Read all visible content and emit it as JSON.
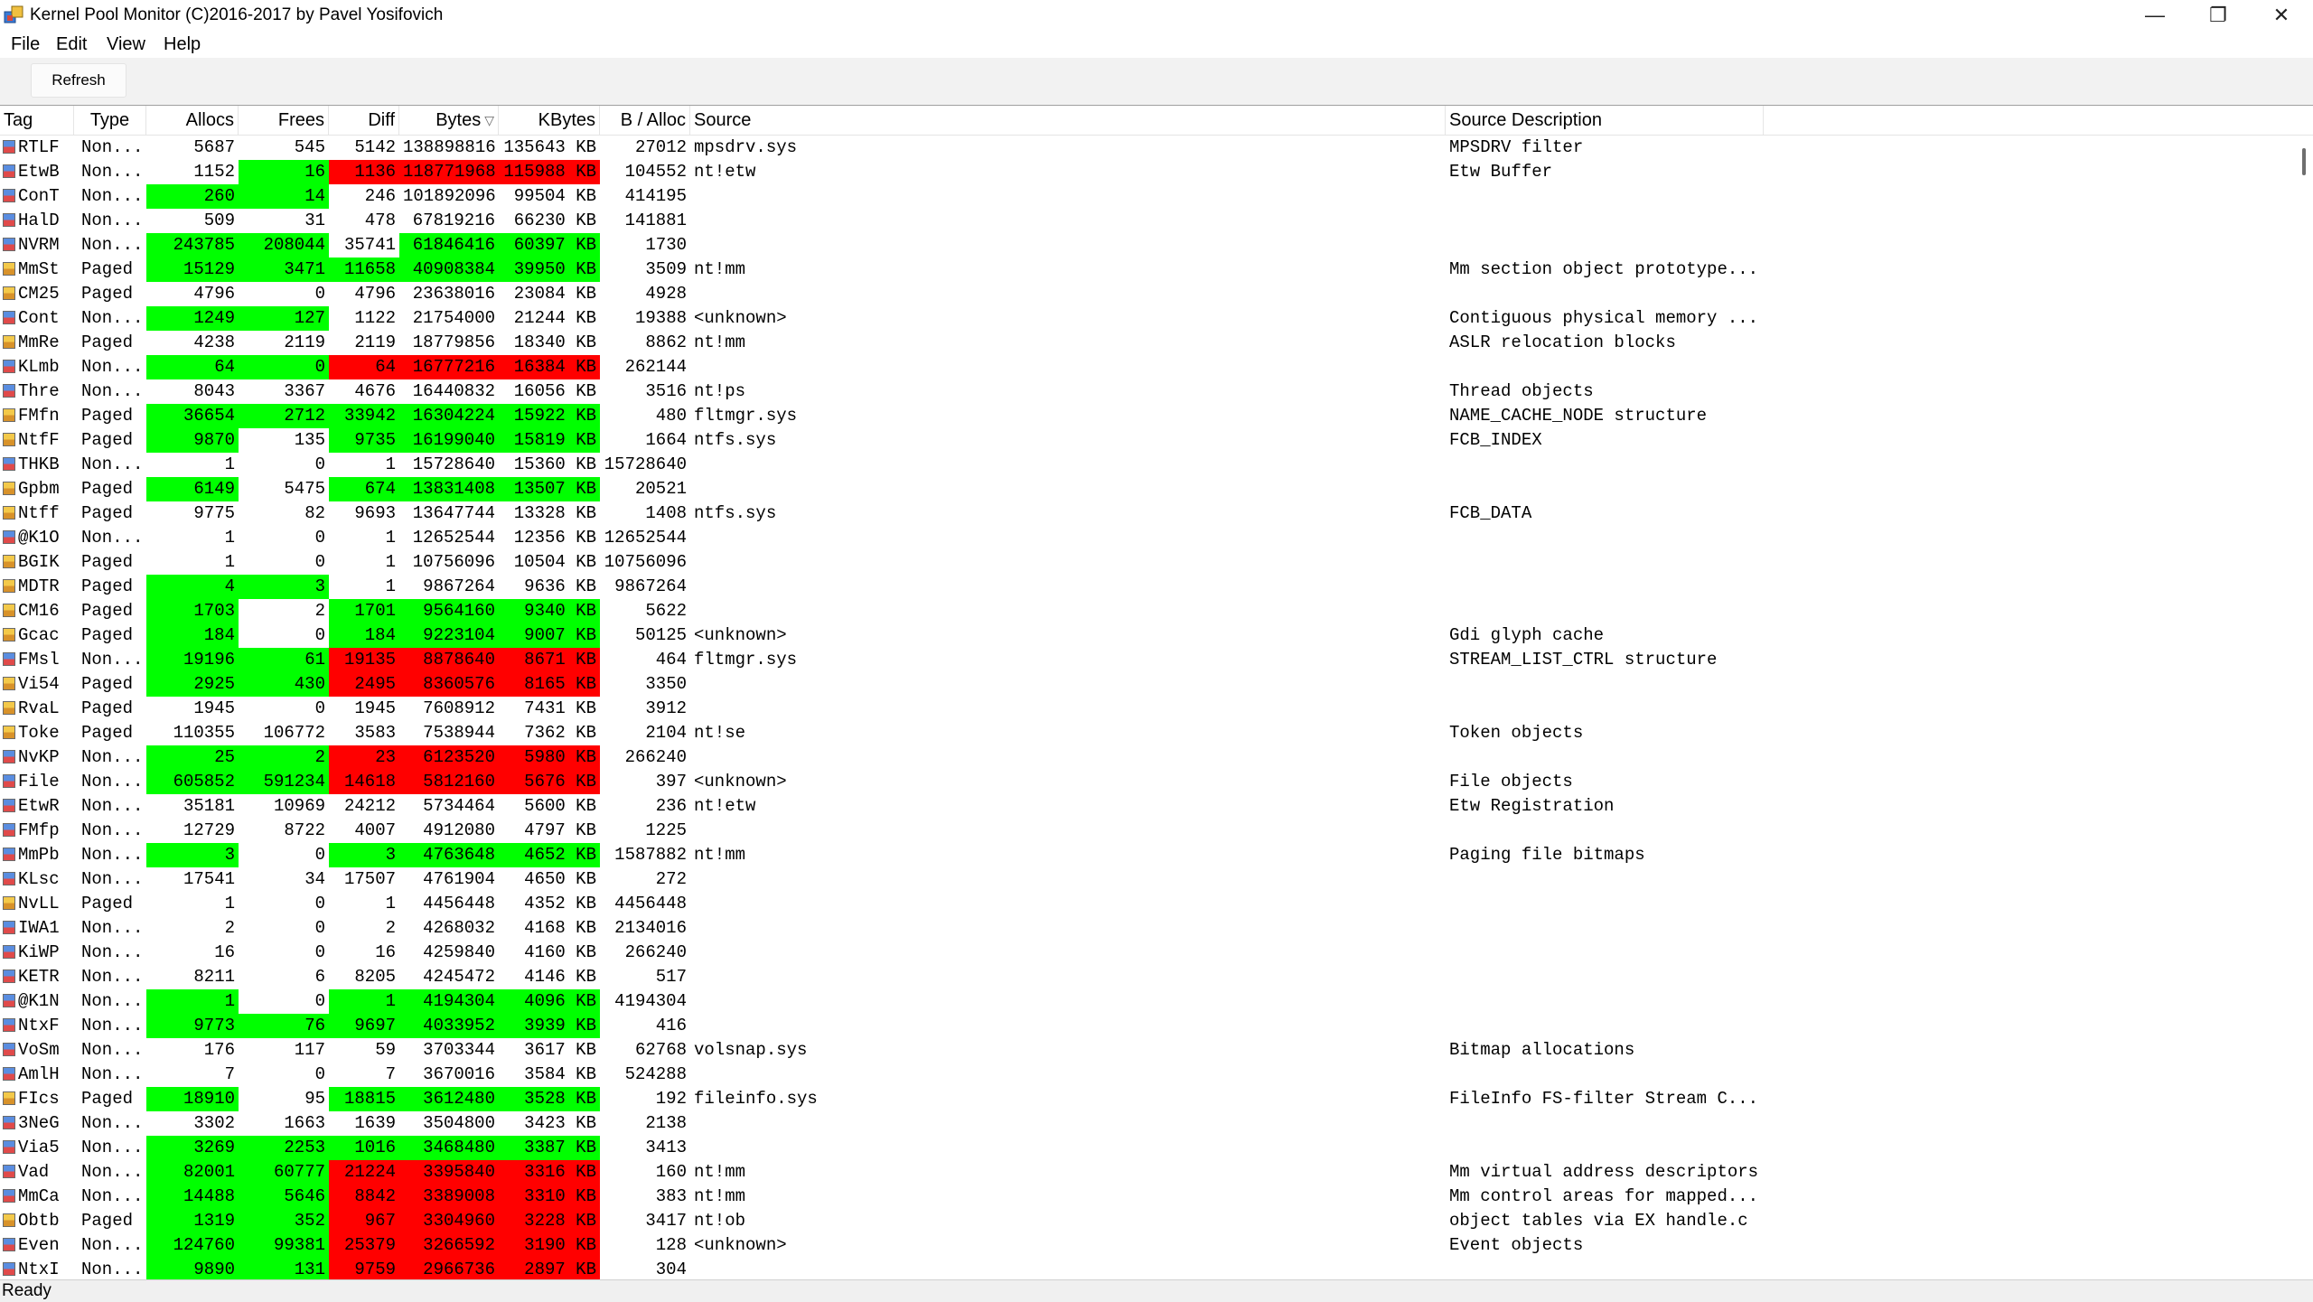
{
  "window": {
    "title": "Kernel Pool Monitor (C)2016-2017 by Pavel Yosifovich",
    "icon": "pool-monitor-icon",
    "controls": {
      "minimize": "—",
      "restore": "❐",
      "close": "✕"
    }
  },
  "menu": {
    "file": "File",
    "edit": "Edit",
    "view": "View",
    "help": "Help"
  },
  "toolbar": {
    "refresh_label": "Refresh"
  },
  "table": {
    "columns": {
      "tag": "Tag",
      "type": "Type",
      "allocs": "Allocs",
      "frees": "Frees",
      "diff": "Diff",
      "bytes": "Bytes",
      "kbytes": "KBytes",
      "balloc": "B / Alloc",
      "source": "Source",
      "desc": "Source Description"
    },
    "sort_column": "Bytes",
    "sort_direction": "descending",
    "colors": {
      "increase": "#00ff00",
      "decrease": "#ff0000"
    },
    "rows": [
      {
        "tag": "RTLF",
        "type": "Non...",
        "allocs": "5687",
        "frees": "545",
        "diff": "5142",
        "bytes": "138898816",
        "kbytes": "135643 KB",
        "balloc": "27012",
        "source": "mpsdrv.sys",
        "desc": "MPSDRV filter",
        "hl": [
          "",
          "",
          "",
          "",
          ""
        ]
      },
      {
        "tag": "EtwB",
        "type": "Non...",
        "allocs": "1152",
        "frees": "16",
        "diff": "1136",
        "bytes": "118771968",
        "kbytes": "115988 KB",
        "balloc": "104552",
        "source": "nt!etw",
        "desc": "Etw Buffer",
        "hl": [
          "",
          "g",
          "rd",
          "rd",
          "rd"
        ]
      },
      {
        "tag": "ConT",
        "type": "Non...",
        "allocs": "260",
        "frees": "14",
        "diff": "246",
        "bytes": "101892096",
        "kbytes": "99504 KB",
        "balloc": "414195",
        "source": "",
        "desc": "",
        "hl": [
          "g",
          "g",
          "",
          "",
          ""
        ]
      },
      {
        "tag": "HalD",
        "type": "Non...",
        "allocs": "509",
        "frees": "31",
        "diff": "478",
        "bytes": "67819216",
        "kbytes": "66230 KB",
        "balloc": "141881",
        "source": "",
        "desc": "",
        "hl": [
          "",
          "",
          "",
          "",
          ""
        ]
      },
      {
        "tag": "NVRM",
        "type": "Non...",
        "allocs": "243785",
        "frees": "208044",
        "diff": "35741",
        "bytes": "61846416",
        "kbytes": "60397 KB",
        "balloc": "1730",
        "source": "",
        "desc": "",
        "hl": [
          "g",
          "g",
          "",
          "g",
          "g"
        ]
      },
      {
        "tag": "MmSt",
        "type": "Paged",
        "allocs": "15129",
        "frees": "3471",
        "diff": "11658",
        "bytes": "40908384",
        "kbytes": "39950 KB",
        "balloc": "3509",
        "source": "nt!mm",
        "desc": "Mm section object prototype...",
        "hl": [
          "g",
          "g",
          "g",
          "g",
          "g"
        ]
      },
      {
        "tag": "CM25",
        "type": "Paged",
        "allocs": "4796",
        "frees": "0",
        "diff": "4796",
        "bytes": "23638016",
        "kbytes": "23084 KB",
        "balloc": "4928",
        "source": "",
        "desc": "",
        "hl": [
          "",
          "",
          "",
          "",
          ""
        ]
      },
      {
        "tag": "Cont",
        "type": "Non...",
        "allocs": "1249",
        "frees": "127",
        "diff": "1122",
        "bytes": "21754000",
        "kbytes": "21244 KB",
        "balloc": "19388",
        "source": "<unknown>",
        "desc": "Contiguous physical memory ...",
        "hl": [
          "g",
          "g",
          "",
          "",
          ""
        ]
      },
      {
        "tag": "MmRe",
        "type": "Paged",
        "allocs": "4238",
        "frees": "2119",
        "diff": "2119",
        "bytes": "18779856",
        "kbytes": "18340 KB",
        "balloc": "8862",
        "source": "nt!mm",
        "desc": "ASLR relocation blocks",
        "hl": [
          "",
          "",
          "",
          "",
          ""
        ]
      },
      {
        "tag": "KLmb",
        "type": "Non...",
        "allocs": "64",
        "frees": "0",
        "diff": "64",
        "bytes": "16777216",
        "kbytes": "16384 KB",
        "balloc": "262144",
        "source": "",
        "desc": "",
        "hl": [
          "g",
          "g",
          "rd",
          "rd",
          "rd"
        ]
      },
      {
        "tag": "Thre",
        "type": "Non...",
        "allocs": "8043",
        "frees": "3367",
        "diff": "4676",
        "bytes": "16440832",
        "kbytes": "16056 KB",
        "balloc": "3516",
        "source": "nt!ps",
        "desc": "Thread objects",
        "hl": [
          "",
          "",
          "",
          "",
          ""
        ]
      },
      {
        "tag": "FMfn",
        "type": "Paged",
        "allocs": "36654",
        "frees": "2712",
        "diff": "33942",
        "bytes": "16304224",
        "kbytes": "15922 KB",
        "balloc": "480",
        "source": "fltmgr.sys",
        "desc": "NAME_CACHE_NODE structure",
        "hl": [
          "g",
          "g",
          "g",
          "g",
          "g"
        ]
      },
      {
        "tag": "NtfF",
        "type": "Paged",
        "allocs": "9870",
        "frees": "135",
        "diff": "9735",
        "bytes": "16199040",
        "kbytes": "15819 KB",
        "balloc": "1664",
        "source": "ntfs.sys",
        "desc": "FCB_INDEX",
        "hl": [
          "g",
          "",
          "g",
          "g",
          "g"
        ]
      },
      {
        "tag": "THKB",
        "type": "Non...",
        "allocs": "1",
        "frees": "0",
        "diff": "1",
        "bytes": "15728640",
        "kbytes": "15360 KB",
        "balloc": "15728640",
        "source": "",
        "desc": "",
        "hl": [
          "",
          "",
          "",
          "",
          ""
        ]
      },
      {
        "tag": "Gpbm",
        "type": "Paged",
        "allocs": "6149",
        "frees": "5475",
        "diff": "674",
        "bytes": "13831408",
        "kbytes": "13507 KB",
        "balloc": "20521",
        "source": "",
        "desc": "",
        "hl": [
          "g",
          "",
          "g",
          "g",
          "g"
        ]
      },
      {
        "tag": "Ntff",
        "type": "Paged",
        "allocs": "9775",
        "frees": "82",
        "diff": "9693",
        "bytes": "13647744",
        "kbytes": "13328 KB",
        "balloc": "1408",
        "source": "ntfs.sys",
        "desc": "FCB_DATA",
        "hl": [
          "",
          "",
          "",
          "",
          ""
        ]
      },
      {
        "tag": "@K1O",
        "type": "Non...",
        "allocs": "1",
        "frees": "0",
        "diff": "1",
        "bytes": "12652544",
        "kbytes": "12356 KB",
        "balloc": "12652544",
        "source": "",
        "desc": "",
        "hl": [
          "",
          "",
          "",
          "",
          ""
        ]
      },
      {
        "tag": "BGIK",
        "type": "Paged",
        "allocs": "1",
        "frees": "0",
        "diff": "1",
        "bytes": "10756096",
        "kbytes": "10504 KB",
        "balloc": "10756096",
        "source": "",
        "desc": "",
        "hl": [
          "",
          "",
          "",
          "",
          ""
        ]
      },
      {
        "tag": "MDTR",
        "type": "Paged",
        "allocs": "4",
        "frees": "3",
        "diff": "1",
        "bytes": "9867264",
        "kbytes": "9636 KB",
        "balloc": "9867264",
        "source": "",
        "desc": "",
        "hl": [
          "g",
          "g",
          "",
          "",
          ""
        ]
      },
      {
        "tag": "CM16",
        "type": "Paged",
        "allocs": "1703",
        "frees": "2",
        "diff": "1701",
        "bytes": "9564160",
        "kbytes": "9340 KB",
        "balloc": "5622",
        "source": "",
        "desc": "",
        "hl": [
          "g",
          "",
          "g",
          "g",
          "g"
        ]
      },
      {
        "tag": "Gcac",
        "type": "Paged",
        "allocs": "184",
        "frees": "0",
        "diff": "184",
        "bytes": "9223104",
        "kbytes": "9007 KB",
        "balloc": "50125",
        "source": "<unknown>",
        "desc": "Gdi glyph cache",
        "hl": [
          "g",
          "",
          "g",
          "g",
          "g"
        ]
      },
      {
        "tag": "FMsl",
        "type": "Non...",
        "allocs": "19196",
        "frees": "61",
        "diff": "19135",
        "bytes": "8878640",
        "kbytes": "8671 KB",
        "balloc": "464",
        "source": "fltmgr.sys",
        "desc": "STREAM_LIST_CTRL structure",
        "hl": [
          "g",
          "g",
          "rd",
          "rd",
          "rd"
        ]
      },
      {
        "tag": "Vi54",
        "type": "Paged",
        "allocs": "2925",
        "frees": "430",
        "diff": "2495",
        "bytes": "8360576",
        "kbytes": "8165 KB",
        "balloc": "3350",
        "source": "",
        "desc": "",
        "hl": [
          "g",
          "g",
          "rd",
          "rd",
          "rd"
        ]
      },
      {
        "tag": "RvaL",
        "type": "Paged",
        "allocs": "1945",
        "frees": "0",
        "diff": "1945",
        "bytes": "7608912",
        "kbytes": "7431 KB",
        "balloc": "3912",
        "source": "",
        "desc": "",
        "hl": [
          "",
          "",
          "",
          "",
          ""
        ]
      },
      {
        "tag": "Toke",
        "type": "Paged",
        "allocs": "110355",
        "frees": "106772",
        "diff": "3583",
        "bytes": "7538944",
        "kbytes": "7362 KB",
        "balloc": "2104",
        "source": "nt!se",
        "desc": "Token objects",
        "hl": [
          "",
          "",
          "",
          "",
          ""
        ]
      },
      {
        "tag": "NvKP",
        "type": "Non...",
        "allocs": "25",
        "frees": "2",
        "diff": "23",
        "bytes": "6123520",
        "kbytes": "5980 KB",
        "balloc": "266240",
        "source": "",
        "desc": "",
        "hl": [
          "g",
          "g",
          "rd",
          "rd",
          "rd"
        ]
      },
      {
        "tag": "File",
        "type": "Non...",
        "allocs": "605852",
        "frees": "591234",
        "diff": "14618",
        "bytes": "5812160",
        "kbytes": "5676 KB",
        "balloc": "397",
        "source": "<unknown>",
        "desc": "File objects",
        "hl": [
          "g",
          "g",
          "rd",
          "rd",
          "rd"
        ]
      },
      {
        "tag": "EtwR",
        "type": "Non...",
        "allocs": "35181",
        "frees": "10969",
        "diff": "24212",
        "bytes": "5734464",
        "kbytes": "5600 KB",
        "balloc": "236",
        "source": "nt!etw",
        "desc": "Etw Registration",
        "hl": [
          "",
          "",
          "",
          "",
          ""
        ]
      },
      {
        "tag": "FMfp",
        "type": "Non...",
        "allocs": "12729",
        "frees": "8722",
        "diff": "4007",
        "bytes": "4912080",
        "kbytes": "4797 KB",
        "balloc": "1225",
        "source": "",
        "desc": "",
        "hl": [
          "",
          "",
          "",
          "",
          ""
        ]
      },
      {
        "tag": "MmPb",
        "type": "Non...",
        "allocs": "3",
        "frees": "0",
        "diff": "3",
        "bytes": "4763648",
        "kbytes": "4652 KB",
        "balloc": "1587882",
        "source": "nt!mm",
        "desc": "Paging file bitmaps",
        "hl": [
          "g",
          "",
          "g",
          "g",
          "g"
        ]
      },
      {
        "tag": "KLsc",
        "type": "Non...",
        "allocs": "17541",
        "frees": "34",
        "diff": "17507",
        "bytes": "4761904",
        "kbytes": "4650 KB",
        "balloc": "272",
        "source": "",
        "desc": "",
        "hl": [
          "",
          "",
          "",
          "",
          ""
        ]
      },
      {
        "tag": "NvLL",
        "type": "Paged",
        "allocs": "1",
        "frees": "0",
        "diff": "1",
        "bytes": "4456448",
        "kbytes": "4352 KB",
        "balloc": "4456448",
        "source": "",
        "desc": "",
        "hl": [
          "",
          "",
          "",
          "",
          ""
        ]
      },
      {
        "tag": "IWA1",
        "type": "Non...",
        "allocs": "2",
        "frees": "0",
        "diff": "2",
        "bytes": "4268032",
        "kbytes": "4168 KB",
        "balloc": "2134016",
        "source": "",
        "desc": "",
        "hl": [
          "",
          "",
          "",
          "",
          ""
        ]
      },
      {
        "tag": "KiWP",
        "type": "Non...",
        "allocs": "16",
        "frees": "0",
        "diff": "16",
        "bytes": "4259840",
        "kbytes": "4160 KB",
        "balloc": "266240",
        "source": "",
        "desc": "",
        "hl": [
          "",
          "",
          "",
          "",
          ""
        ]
      },
      {
        "tag": "KETR",
        "type": "Non...",
        "allocs": "8211",
        "frees": "6",
        "diff": "8205",
        "bytes": "4245472",
        "kbytes": "4146 KB",
        "balloc": "517",
        "source": "",
        "desc": "",
        "hl": [
          "",
          "",
          "",
          "",
          ""
        ]
      },
      {
        "tag": "@K1N",
        "type": "Non...",
        "allocs": "1",
        "frees": "0",
        "diff": "1",
        "bytes": "4194304",
        "kbytes": "4096 KB",
        "balloc": "4194304",
        "source": "",
        "desc": "",
        "hl": [
          "g",
          "",
          "g",
          "g",
          "g"
        ]
      },
      {
        "tag": "NtxF",
        "type": "Non...",
        "allocs": "9773",
        "frees": "76",
        "diff": "9697",
        "bytes": "4033952",
        "kbytes": "3939 KB",
        "balloc": "416",
        "source": "",
        "desc": "",
        "hl": [
          "g",
          "g",
          "g",
          "g",
          "g"
        ]
      },
      {
        "tag": "VoSm",
        "type": "Non...",
        "allocs": "176",
        "frees": "117",
        "diff": "59",
        "bytes": "3703344",
        "kbytes": "3617 KB",
        "balloc": "62768",
        "source": "volsnap.sys",
        "desc": "Bitmap allocations",
        "hl": [
          "",
          "",
          "",
          "",
          ""
        ]
      },
      {
        "tag": "AmlH",
        "type": "Non...",
        "allocs": "7",
        "frees": "0",
        "diff": "7",
        "bytes": "3670016",
        "kbytes": "3584 KB",
        "balloc": "524288",
        "source": "",
        "desc": "",
        "hl": [
          "",
          "",
          "",
          "",
          ""
        ]
      },
      {
        "tag": "FIcs",
        "type": "Paged",
        "allocs": "18910",
        "frees": "95",
        "diff": "18815",
        "bytes": "3612480",
        "kbytes": "3528 KB",
        "balloc": "192",
        "source": "fileinfo.sys",
        "desc": "FileInfo FS-filter Stream C...",
        "hl": [
          "g",
          "",
          "g",
          "g",
          "g"
        ]
      },
      {
        "tag": "3NeG",
        "type": "Non...",
        "allocs": "3302",
        "frees": "1663",
        "diff": "1639",
        "bytes": "3504800",
        "kbytes": "3423 KB",
        "balloc": "2138",
        "source": "",
        "desc": "",
        "hl": [
          "",
          "",
          "",
          "",
          ""
        ]
      },
      {
        "tag": "Via5",
        "type": "Non...",
        "allocs": "3269",
        "frees": "2253",
        "diff": "1016",
        "bytes": "3468480",
        "kbytes": "3387 KB",
        "balloc": "3413",
        "source": "",
        "desc": "",
        "hl": [
          "g",
          "g",
          "g",
          "g",
          "g"
        ]
      },
      {
        "tag": "Vad",
        "type": "Non...",
        "allocs": "82001",
        "frees": "60777",
        "diff": "21224",
        "bytes": "3395840",
        "kbytes": "3316 KB",
        "balloc": "160",
        "source": "nt!mm",
        "desc": "Mm virtual address descriptors",
        "hl": [
          "g",
          "g",
          "rd",
          "rd",
          "rd"
        ]
      },
      {
        "tag": "MmCa",
        "type": "Non...",
        "allocs": "14488",
        "frees": "5646",
        "diff": "8842",
        "bytes": "3389008",
        "kbytes": "3310 KB",
        "balloc": "383",
        "source": "nt!mm",
        "desc": "Mm control areas for mapped...",
        "hl": [
          "g",
          "g",
          "rd",
          "rd",
          "rd"
        ]
      },
      {
        "tag": "Obtb",
        "type": "Paged",
        "allocs": "1319",
        "frees": "352",
        "diff": "967",
        "bytes": "3304960",
        "kbytes": "3228 KB",
        "balloc": "3417",
        "source": "nt!ob",
        "desc": "object tables via EX handle.c",
        "hl": [
          "g",
          "g",
          "rd",
          "rd",
          "rd"
        ]
      },
      {
        "tag": "Even",
        "type": "Non...",
        "allocs": "124760",
        "frees": "99381",
        "diff": "25379",
        "bytes": "3266592",
        "kbytes": "3190 KB",
        "balloc": "128",
        "source": "<unknown>",
        "desc": "Event objects",
        "hl": [
          "g",
          "g",
          "rd",
          "rd",
          "rd"
        ]
      },
      {
        "tag": "NtxI",
        "type": "Non...",
        "allocs": "9890",
        "frees": "131",
        "diff": "9759",
        "bytes": "2966736",
        "kbytes": "2897 KB",
        "balloc": "304",
        "source": "",
        "desc": "",
        "hl": [
          "g",
          "g",
          "rd",
          "rd",
          "rd"
        ]
      }
    ]
  },
  "status": {
    "text": "Ready"
  }
}
